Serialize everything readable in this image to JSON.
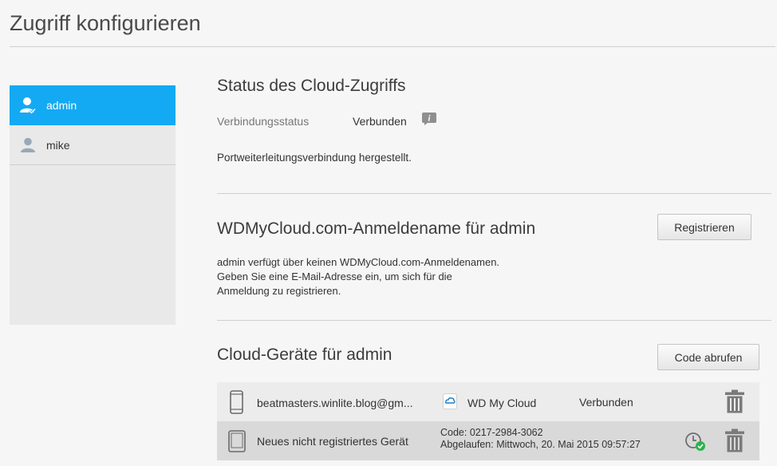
{
  "page": {
    "title": "Zugriff konfigurieren"
  },
  "sidebar": {
    "users": [
      {
        "name": "admin",
        "active": true
      },
      {
        "name": "mike",
        "active": false
      }
    ]
  },
  "status": {
    "title": "Status des Cloud-Zugriffs",
    "connection_label": "Verbindungsstatus",
    "connection_value": "Verbunden",
    "message": "Portweiterleitungsverbindung hergestellt."
  },
  "login": {
    "title": "WDMyCloud.com-Anmeldename für admin",
    "register_label": "Registrieren",
    "line1": "admin verfügt über keinen WDMyCloud.com-Anmeldenamen.",
    "line2": "Geben Sie eine E-Mail-Adresse ein, um sich für die",
    "line3": "Anmeldung zu registrieren."
  },
  "devices": {
    "title": "Cloud-Geräte für admin",
    "get_code_label": "Code abrufen",
    "rows": [
      {
        "name": "beatmasters.winlite.blog@gm...",
        "app": "WD My Cloud",
        "status": "Verbunden"
      },
      {
        "name": "Neues nicht registriertes Gerät",
        "code": "Code: 0217-2984-3062",
        "expires": "Abgelaufen: Mittwoch, 20. Mai 2015 09:57:27"
      }
    ]
  },
  "colors": {
    "accent": "#14a9f3",
    "check_green": "#2bb34a"
  }
}
